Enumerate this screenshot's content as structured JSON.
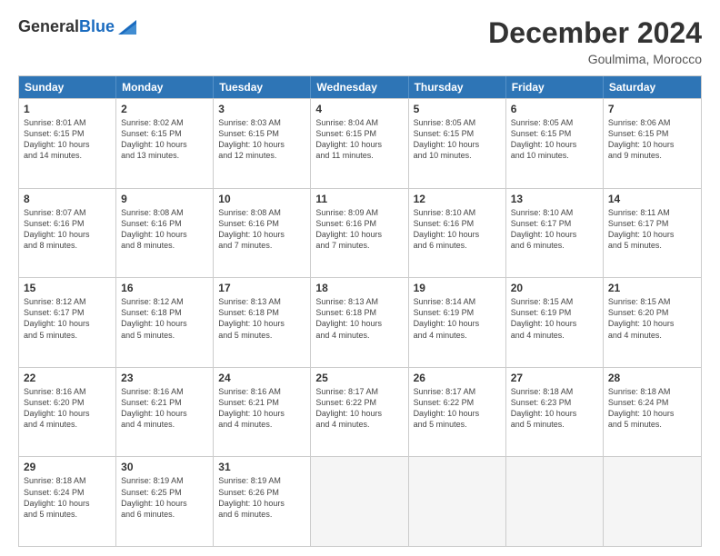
{
  "header": {
    "logo_general": "General",
    "logo_blue": "Blue",
    "main_title": "December 2024",
    "subtitle": "Goulmima, Morocco"
  },
  "days_of_week": [
    "Sunday",
    "Monday",
    "Tuesday",
    "Wednesday",
    "Thursday",
    "Friday",
    "Saturday"
  ],
  "weeks": [
    [
      {
        "day": "1",
        "info": "Sunrise: 8:01 AM\nSunset: 6:15 PM\nDaylight: 10 hours\nand 14 minutes."
      },
      {
        "day": "2",
        "info": "Sunrise: 8:02 AM\nSunset: 6:15 PM\nDaylight: 10 hours\nand 13 minutes."
      },
      {
        "day": "3",
        "info": "Sunrise: 8:03 AM\nSunset: 6:15 PM\nDaylight: 10 hours\nand 12 minutes."
      },
      {
        "day": "4",
        "info": "Sunrise: 8:04 AM\nSunset: 6:15 PM\nDaylight: 10 hours\nand 11 minutes."
      },
      {
        "day": "5",
        "info": "Sunrise: 8:05 AM\nSunset: 6:15 PM\nDaylight: 10 hours\nand 10 minutes."
      },
      {
        "day": "6",
        "info": "Sunrise: 8:05 AM\nSunset: 6:15 PM\nDaylight: 10 hours\nand 10 minutes."
      },
      {
        "day": "7",
        "info": "Sunrise: 8:06 AM\nSunset: 6:15 PM\nDaylight: 10 hours\nand 9 minutes."
      }
    ],
    [
      {
        "day": "8",
        "info": "Sunrise: 8:07 AM\nSunset: 6:16 PM\nDaylight: 10 hours\nand 8 minutes."
      },
      {
        "day": "9",
        "info": "Sunrise: 8:08 AM\nSunset: 6:16 PM\nDaylight: 10 hours\nand 8 minutes."
      },
      {
        "day": "10",
        "info": "Sunrise: 8:08 AM\nSunset: 6:16 PM\nDaylight: 10 hours\nand 7 minutes."
      },
      {
        "day": "11",
        "info": "Sunrise: 8:09 AM\nSunset: 6:16 PM\nDaylight: 10 hours\nand 7 minutes."
      },
      {
        "day": "12",
        "info": "Sunrise: 8:10 AM\nSunset: 6:16 PM\nDaylight: 10 hours\nand 6 minutes."
      },
      {
        "day": "13",
        "info": "Sunrise: 8:10 AM\nSunset: 6:17 PM\nDaylight: 10 hours\nand 6 minutes."
      },
      {
        "day": "14",
        "info": "Sunrise: 8:11 AM\nSunset: 6:17 PM\nDaylight: 10 hours\nand 5 minutes."
      }
    ],
    [
      {
        "day": "15",
        "info": "Sunrise: 8:12 AM\nSunset: 6:17 PM\nDaylight: 10 hours\nand 5 minutes."
      },
      {
        "day": "16",
        "info": "Sunrise: 8:12 AM\nSunset: 6:18 PM\nDaylight: 10 hours\nand 5 minutes."
      },
      {
        "day": "17",
        "info": "Sunrise: 8:13 AM\nSunset: 6:18 PM\nDaylight: 10 hours\nand 5 minutes."
      },
      {
        "day": "18",
        "info": "Sunrise: 8:13 AM\nSunset: 6:18 PM\nDaylight: 10 hours\nand 4 minutes."
      },
      {
        "day": "19",
        "info": "Sunrise: 8:14 AM\nSunset: 6:19 PM\nDaylight: 10 hours\nand 4 minutes."
      },
      {
        "day": "20",
        "info": "Sunrise: 8:15 AM\nSunset: 6:19 PM\nDaylight: 10 hours\nand 4 minutes."
      },
      {
        "day": "21",
        "info": "Sunrise: 8:15 AM\nSunset: 6:20 PM\nDaylight: 10 hours\nand 4 minutes."
      }
    ],
    [
      {
        "day": "22",
        "info": "Sunrise: 8:16 AM\nSunset: 6:20 PM\nDaylight: 10 hours\nand 4 minutes."
      },
      {
        "day": "23",
        "info": "Sunrise: 8:16 AM\nSunset: 6:21 PM\nDaylight: 10 hours\nand 4 minutes."
      },
      {
        "day": "24",
        "info": "Sunrise: 8:16 AM\nSunset: 6:21 PM\nDaylight: 10 hours\nand 4 minutes."
      },
      {
        "day": "25",
        "info": "Sunrise: 8:17 AM\nSunset: 6:22 PM\nDaylight: 10 hours\nand 4 minutes."
      },
      {
        "day": "26",
        "info": "Sunrise: 8:17 AM\nSunset: 6:22 PM\nDaylight: 10 hours\nand 5 minutes."
      },
      {
        "day": "27",
        "info": "Sunrise: 8:18 AM\nSunset: 6:23 PM\nDaylight: 10 hours\nand 5 minutes."
      },
      {
        "day": "28",
        "info": "Sunrise: 8:18 AM\nSunset: 6:24 PM\nDaylight: 10 hours\nand 5 minutes."
      }
    ],
    [
      {
        "day": "29",
        "info": "Sunrise: 8:18 AM\nSunset: 6:24 PM\nDaylight: 10 hours\nand 5 minutes."
      },
      {
        "day": "30",
        "info": "Sunrise: 8:19 AM\nSunset: 6:25 PM\nDaylight: 10 hours\nand 6 minutes."
      },
      {
        "day": "31",
        "info": "Sunrise: 8:19 AM\nSunset: 6:26 PM\nDaylight: 10 hours\nand 6 minutes."
      },
      {
        "day": "",
        "info": ""
      },
      {
        "day": "",
        "info": ""
      },
      {
        "day": "",
        "info": ""
      },
      {
        "day": "",
        "info": ""
      }
    ]
  ]
}
